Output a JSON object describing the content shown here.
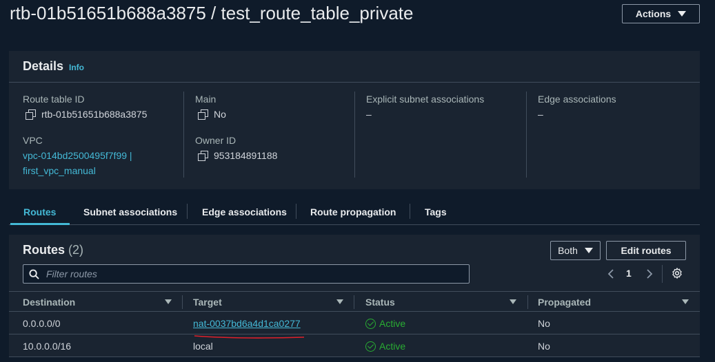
{
  "header": {
    "title": "rtb-01b51651b688a3875 / test_route_table_private",
    "actions_label": "Actions"
  },
  "details": {
    "title": "Details",
    "info_label": "Info",
    "route_table_id_label": "Route table ID",
    "route_table_id": "rtb-01b51651b688a3875",
    "vpc_label": "VPC",
    "vpc_line1": "vpc-014bd2500495f7f99 |",
    "vpc_line2": "first_vpc_manual",
    "main_label": "Main",
    "main_value": "No",
    "owner_id_label": "Owner ID",
    "owner_id": "953184891188",
    "explicit_subnet_label": "Explicit subnet associations",
    "explicit_subnet_value": "–",
    "edge_assoc_label": "Edge associations",
    "edge_assoc_value": "–"
  },
  "tabs": [
    {
      "label": "Routes",
      "active": true
    },
    {
      "label": "Subnet associations",
      "active": false
    },
    {
      "label": "Edge associations",
      "active": false
    },
    {
      "label": "Route propagation",
      "active": false
    },
    {
      "label": "Tags",
      "active": false
    }
  ],
  "routes": {
    "title": "Routes",
    "count": "(2)",
    "filter_select": "Both",
    "edit_label": "Edit routes",
    "filter_placeholder": "Filter routes",
    "page": "1",
    "columns": [
      "Destination",
      "Target",
      "Status",
      "Propagated"
    ],
    "rows": [
      {
        "destination": "0.0.0.0/0",
        "target": "nat-0037bd6a4d1ca0277",
        "target_is_link": true,
        "status": "Active",
        "propagated": "No"
      },
      {
        "destination": "10.0.0.0/16",
        "target": "local",
        "target_is_link": false,
        "status": "Active",
        "propagated": "No"
      }
    ]
  },
  "colors": {
    "background": "#0f1b2a",
    "panel": "#1a2431",
    "link": "#44b9d6",
    "success": "#29ad32",
    "annotation": "#e0202a"
  },
  "icons": [
    "caret-down-icon",
    "copy-icon",
    "search-icon",
    "chevron-left-icon",
    "chevron-right-icon",
    "gear-icon",
    "status-ok-icon",
    "sort-caret-icon"
  ]
}
